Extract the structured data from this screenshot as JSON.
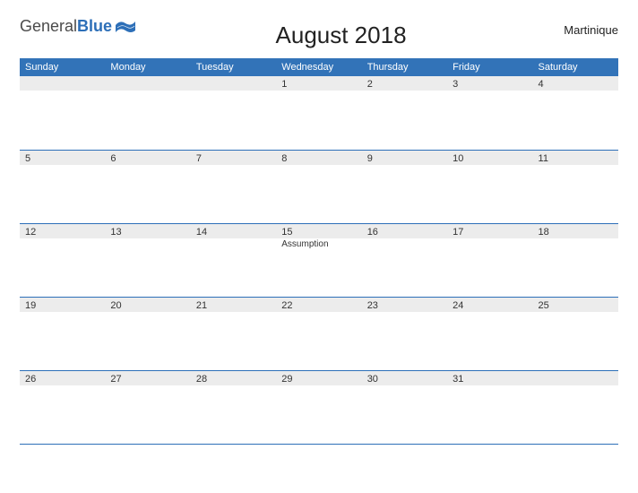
{
  "logo": {
    "word1": "General",
    "word2": "Blue"
  },
  "title": "August 2018",
  "region": "Martinique",
  "day_headers": [
    "Sunday",
    "Monday",
    "Tuesday",
    "Wednesday",
    "Thursday",
    "Friday",
    "Saturday"
  ],
  "weeks": [
    [
      {
        "n": "",
        "e": ""
      },
      {
        "n": "",
        "e": ""
      },
      {
        "n": "",
        "e": ""
      },
      {
        "n": "1",
        "e": ""
      },
      {
        "n": "2",
        "e": ""
      },
      {
        "n": "3",
        "e": ""
      },
      {
        "n": "4",
        "e": ""
      }
    ],
    [
      {
        "n": "5",
        "e": ""
      },
      {
        "n": "6",
        "e": ""
      },
      {
        "n": "7",
        "e": ""
      },
      {
        "n": "8",
        "e": ""
      },
      {
        "n": "9",
        "e": ""
      },
      {
        "n": "10",
        "e": ""
      },
      {
        "n": "11",
        "e": ""
      }
    ],
    [
      {
        "n": "12",
        "e": ""
      },
      {
        "n": "13",
        "e": ""
      },
      {
        "n": "14",
        "e": ""
      },
      {
        "n": "15",
        "e": "Assumption"
      },
      {
        "n": "16",
        "e": ""
      },
      {
        "n": "17",
        "e": ""
      },
      {
        "n": "18",
        "e": ""
      }
    ],
    [
      {
        "n": "19",
        "e": ""
      },
      {
        "n": "20",
        "e": ""
      },
      {
        "n": "21",
        "e": ""
      },
      {
        "n": "22",
        "e": ""
      },
      {
        "n": "23",
        "e": ""
      },
      {
        "n": "24",
        "e": ""
      },
      {
        "n": "25",
        "e": ""
      }
    ],
    [
      {
        "n": "26",
        "e": ""
      },
      {
        "n": "27",
        "e": ""
      },
      {
        "n": "28",
        "e": ""
      },
      {
        "n": "29",
        "e": ""
      },
      {
        "n": "30",
        "e": ""
      },
      {
        "n": "31",
        "e": ""
      },
      {
        "n": "",
        "e": ""
      }
    ]
  ]
}
